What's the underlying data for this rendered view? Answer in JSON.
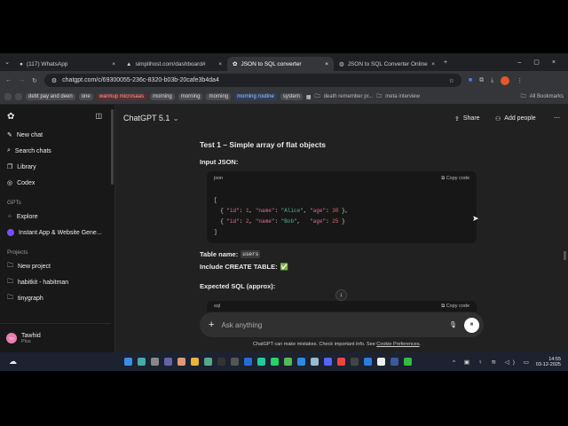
{
  "browser": {
    "tabs": [
      {
        "title": "(117) WhatsApp"
      },
      {
        "title": "simplihost.com/dashboard#"
      },
      {
        "title": "JSON to SQL converter",
        "active": true
      },
      {
        "title": "JSON to SQL Converter Online"
      }
    ],
    "url": "chatgpt.com/c/69300055-236c-8320-b03b-20cafe3b4da4",
    "bookmarks": [
      "debt pay and deen",
      "one",
      "warmup microsaas",
      "morning",
      "morning",
      "morning",
      "morning routine",
      "system",
      "death remember pr...",
      "meta interview",
      "All Bookmarks"
    ]
  },
  "sidebar": {
    "items": [
      "New chat",
      "Search chats",
      "Library",
      "Codex"
    ],
    "gpts_heading": "GPTs",
    "gpts": [
      "Explore",
      "Instant App & Website Gene..."
    ],
    "projects_heading": "Projects",
    "projects": [
      "New project",
      "habitkit - habitman",
      "tinygraph"
    ],
    "user": {
      "initials": "TA",
      "name": "Tawhid",
      "plan": "Plus"
    }
  },
  "header": {
    "model": "ChatGPT 5.1",
    "share": "Share",
    "add_people": "Add people"
  },
  "content": {
    "heading": "Test 1 – Simple array of flat objects",
    "input_label": "Input JSON:",
    "code1_lang": "json",
    "copy_code": "Copy code",
    "table_label": "Table name:",
    "table_value": "users",
    "create_label": "Include CREATE TABLE:",
    "create_value": "✅",
    "expected_label": "Expected SQL (approx):",
    "code2_lang": "sql"
  },
  "composer": {
    "placeholder": "Ask anything",
    "disclaimer": "ChatGPT can make mistakes. Check important info. See ",
    "link": "Cookie Preferences",
    "end": "."
  },
  "taskbar": {
    "time": "14:55",
    "date": "03-12-2025"
  }
}
